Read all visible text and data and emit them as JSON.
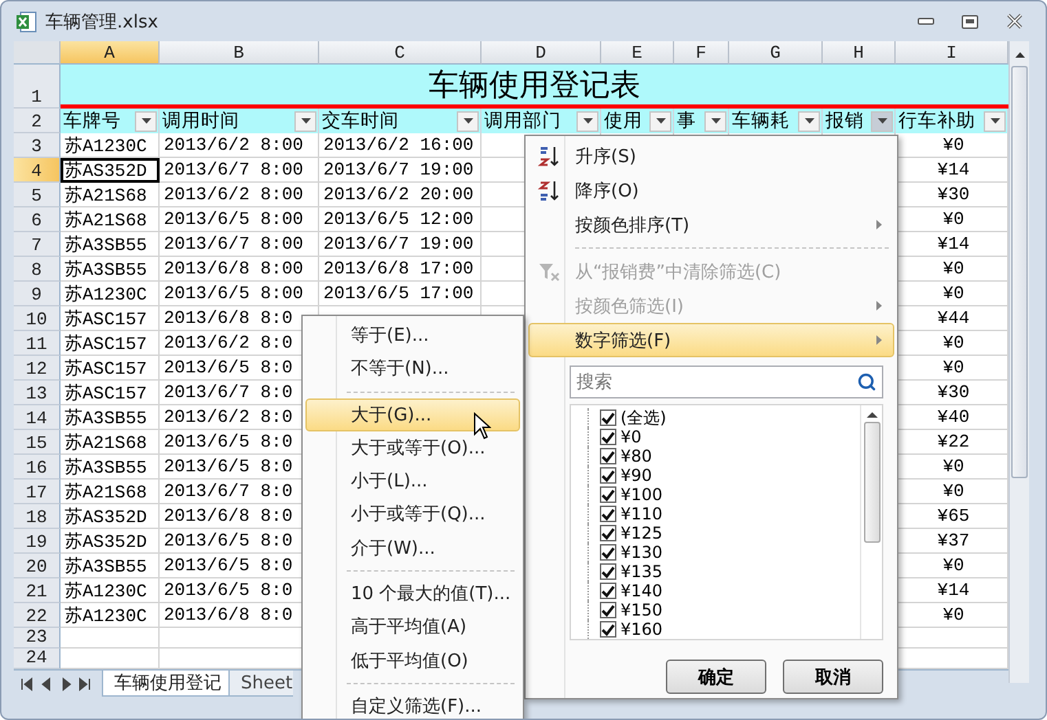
{
  "window": {
    "title": "车辆管理.xlsx"
  },
  "column_headers": [
    {
      "label": "A",
      "selected": true
    },
    {
      "label": "B",
      "selected": false
    },
    {
      "label": "C",
      "selected": false
    },
    {
      "label": "D",
      "selected": false
    },
    {
      "label": "E",
      "selected": false
    },
    {
      "label": "F",
      "selected": false
    },
    {
      "label": "G",
      "selected": false
    },
    {
      "label": "H",
      "selected": false
    },
    {
      "label": "I",
      "selected": false
    }
  ],
  "title_row": {
    "row": "1",
    "text": "车辆使用登记表"
  },
  "header_row": {
    "row": "2",
    "cells": [
      {
        "label": "车牌号",
        "filter_open": false
      },
      {
        "label": "调用时间",
        "filter_open": false
      },
      {
        "label": "交车时间",
        "filter_open": false
      },
      {
        "label": "调用部门",
        "filter_open": false
      },
      {
        "label": "使用",
        "filter_open": false
      },
      {
        "label": "事",
        "filter_open": false
      },
      {
        "label": "车辆耗",
        "filter_open": false
      },
      {
        "label": "报销",
        "filter_open": true
      },
      {
        "label": "行车补助",
        "filter_open": false
      }
    ]
  },
  "rows": [
    {
      "row": "3",
      "selected": false,
      "cells": [
        "苏A1230C",
        "2013/6/2 8:00",
        "2013/6/2 16:00"
      ],
      "column_i": "¥0"
    },
    {
      "row": "4",
      "selected": true,
      "cells": [
        "苏AS352D",
        "2013/6/7 8:00",
        "2013/6/7 19:00"
      ],
      "column_i": "¥14"
    },
    {
      "row": "5",
      "selected": false,
      "cells": [
        "苏A21S68",
        "2013/6/2 8:00",
        "2013/6/2 20:00"
      ],
      "column_i": "¥30"
    },
    {
      "row": "6",
      "selected": false,
      "cells": [
        "苏A21S68",
        "2013/6/5 8:00",
        "2013/6/5 12:00"
      ],
      "column_i": "¥0"
    },
    {
      "row": "7",
      "selected": false,
      "cells": [
        "苏A3SB55",
        "2013/6/7 8:00",
        "2013/6/7 19:00"
      ],
      "column_i": "¥14"
    },
    {
      "row": "8",
      "selected": false,
      "cells": [
        "苏A3SB55",
        "2013/6/8 8:00",
        "2013/6/8 17:00"
      ],
      "column_i": "¥0"
    },
    {
      "row": "9",
      "selected": false,
      "cells": [
        "苏A1230C",
        "2013/6/5 8:00",
        "2013/6/5 17:00"
      ],
      "column_i": "¥0"
    },
    {
      "row": "10",
      "selected": false,
      "cells": [
        "苏ASC157",
        "2013/6/8 8:0"
      ],
      "column_i": "¥44"
    },
    {
      "row": "11",
      "selected": false,
      "cells": [
        "苏ASC157",
        "2013/6/2 8:0"
      ],
      "column_i": "¥0"
    },
    {
      "row": "12",
      "selected": false,
      "cells": [
        "苏ASC157",
        "2013/6/5 8:0"
      ],
      "column_i": "¥0"
    },
    {
      "row": "13",
      "selected": false,
      "cells": [
        "苏ASC157",
        "2013/6/7 8:0"
      ],
      "column_i": "¥30"
    },
    {
      "row": "14",
      "selected": false,
      "cells": [
        "苏A3SB55",
        "2013/6/2 8:0"
      ],
      "column_i": "¥40"
    },
    {
      "row": "15",
      "selected": false,
      "cells": [
        "苏A21S68",
        "2013/6/5 8:0"
      ],
      "column_i": "¥22"
    },
    {
      "row": "16",
      "selected": false,
      "cells": [
        "苏A3SB55",
        "2013/6/5 8:0"
      ],
      "column_i": "¥0"
    },
    {
      "row": "17",
      "selected": false,
      "cells": [
        "苏A21S68",
        "2013/6/7 8:0"
      ],
      "column_i": "¥0"
    },
    {
      "row": "18",
      "selected": false,
      "cells": [
        "苏AS352D",
        "2013/6/8 8:0"
      ],
      "column_i": "¥65"
    },
    {
      "row": "19",
      "selected": false,
      "cells": [
        "苏AS352D",
        "2013/6/5 8:0"
      ],
      "column_i": "¥37"
    },
    {
      "row": "20",
      "selected": false,
      "cells": [
        "苏A3SB55",
        "2013/6/5 8:0"
      ],
      "column_i": "¥0"
    },
    {
      "row": "21",
      "selected": false,
      "cells": [
        "苏A1230C",
        "2013/6/5 8:0"
      ],
      "column_i": "¥14"
    },
    {
      "row": "22",
      "selected": false,
      "cells": [
        "苏A1230C",
        "2013/6/8 8:0"
      ],
      "column_i": "¥0"
    }
  ],
  "empty_rows": [
    "23",
    "24"
  ],
  "sheet_tabs": [
    {
      "label": "车辆使用登记",
      "selected": true
    },
    {
      "label": "Sheet",
      "selected": false
    }
  ],
  "filter_menu": {
    "items": [
      {
        "kind": "sort_asc",
        "label": "升序(S)",
        "disabled": false,
        "highlighted": false,
        "submenu": false
      },
      {
        "kind": "sort_desc",
        "label": "降序(O)",
        "disabled": false,
        "highlighted": false,
        "submenu": false
      },
      {
        "kind": "item",
        "label": "按颜色排序(T)",
        "disabled": false,
        "highlighted": false,
        "submenu": true
      },
      {
        "kind": "separator"
      },
      {
        "kind": "clear",
        "label": "从“报销费”中清除筛选(C)",
        "disabled": true,
        "highlighted": false,
        "submenu": false
      },
      {
        "kind": "item",
        "label": "按颜色筛选(I)",
        "disabled": true,
        "highlighted": false,
        "submenu": true
      },
      {
        "kind": "item",
        "label": "数字筛选(F)",
        "disabled": false,
        "highlighted": true,
        "submenu": true
      }
    ],
    "search": {
      "placeholder": "搜索"
    },
    "values": [
      {
        "label": "(全选)",
        "checked": true
      },
      {
        "label": "¥0",
        "checked": true
      },
      {
        "label": "¥80",
        "checked": true
      },
      {
        "label": "¥90",
        "checked": true
      },
      {
        "label": "¥100",
        "checked": true
      },
      {
        "label": "¥110",
        "checked": true
      },
      {
        "label": "¥125",
        "checked": true
      },
      {
        "label": "¥130",
        "checked": true
      },
      {
        "label": "¥135",
        "checked": true
      },
      {
        "label": "¥140",
        "checked": true
      },
      {
        "label": "¥150",
        "checked": true
      },
      {
        "label": "¥160",
        "checked": true
      }
    ],
    "buttons": [
      "确定",
      "取消"
    ]
  },
  "number_filter_menu": {
    "items": [
      {
        "kind": "item",
        "label": "等于(E)...",
        "selected": false
      },
      {
        "kind": "item",
        "label": "不等于(N)...",
        "selected": false
      },
      {
        "kind": "separator"
      },
      {
        "kind": "item",
        "label": "大于(G)...",
        "selected": true
      },
      {
        "kind": "item",
        "label": "大于或等于(O)...",
        "selected": false
      },
      {
        "kind": "item",
        "label": "小于(L)...",
        "selected": false
      },
      {
        "kind": "item",
        "label": "小于或等于(Q)...",
        "selected": false
      },
      {
        "kind": "item",
        "label": "介于(W)...",
        "selected": false
      },
      {
        "kind": "separator"
      },
      {
        "kind": "item",
        "label": "10 个最大的值(T)...",
        "selected": false
      },
      {
        "kind": "item",
        "label": "高于平均值(A)",
        "selected": false
      },
      {
        "kind": "item",
        "label": "低于平均值(O)",
        "selected": false
      },
      {
        "kind": "separator"
      },
      {
        "kind": "item",
        "label": "自定义筛选(F)...",
        "selected": false
      }
    ]
  }
}
